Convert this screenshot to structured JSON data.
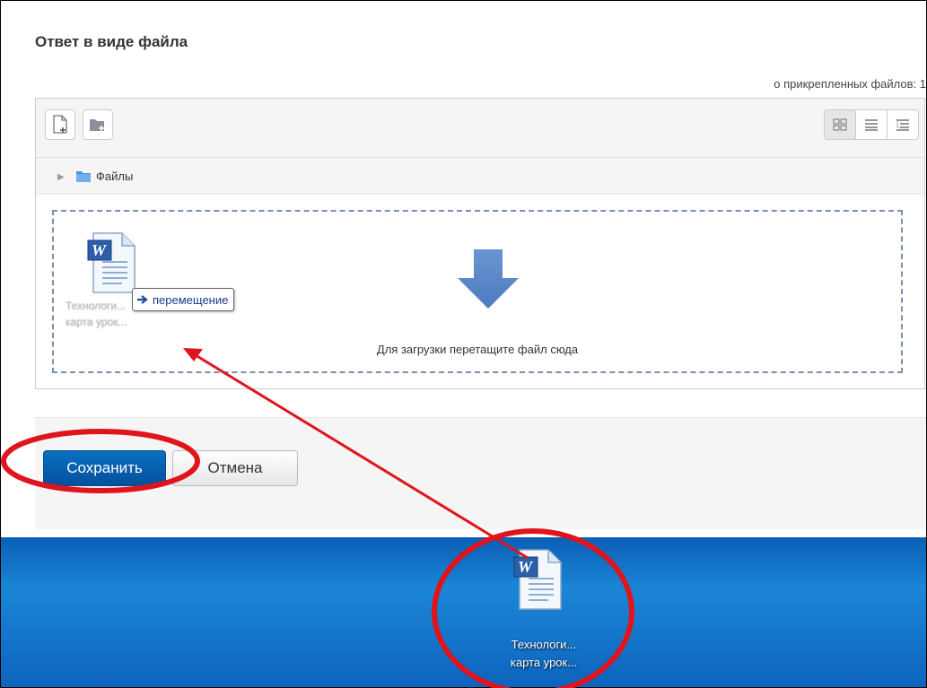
{
  "section": {
    "title": "Ответ в виде файла"
  },
  "filemanager": {
    "max_files_text": "о прикрепленных файлов: 1",
    "toolbar": {
      "add_file_icon": "add-file-icon",
      "create_folder_icon": "create-folder-icon",
      "view_icons": "grid-view-icon",
      "view_list": "list-view-icon",
      "view_tree": "tree-view-icon"
    },
    "path": {
      "folder_label": "Файлы"
    },
    "dragged_file": {
      "name_line1": "Технологи...",
      "name_line2": "карта урок..."
    },
    "move_tooltip": "перемещение",
    "drop_text": "Для загрузки перетащите файл сюда"
  },
  "form": {
    "save_label": "Сохранить",
    "cancel_label": "Отмена"
  },
  "desktop": {
    "file_name_line1": "Технологи...",
    "file_name_line2": "карта урок..."
  },
  "colors": {
    "accent_blue": "#0a6fc2",
    "annotation_red": "#e0141c",
    "desktop_blue": "#1b86d6",
    "dashed_border": "#7b8fb3"
  }
}
